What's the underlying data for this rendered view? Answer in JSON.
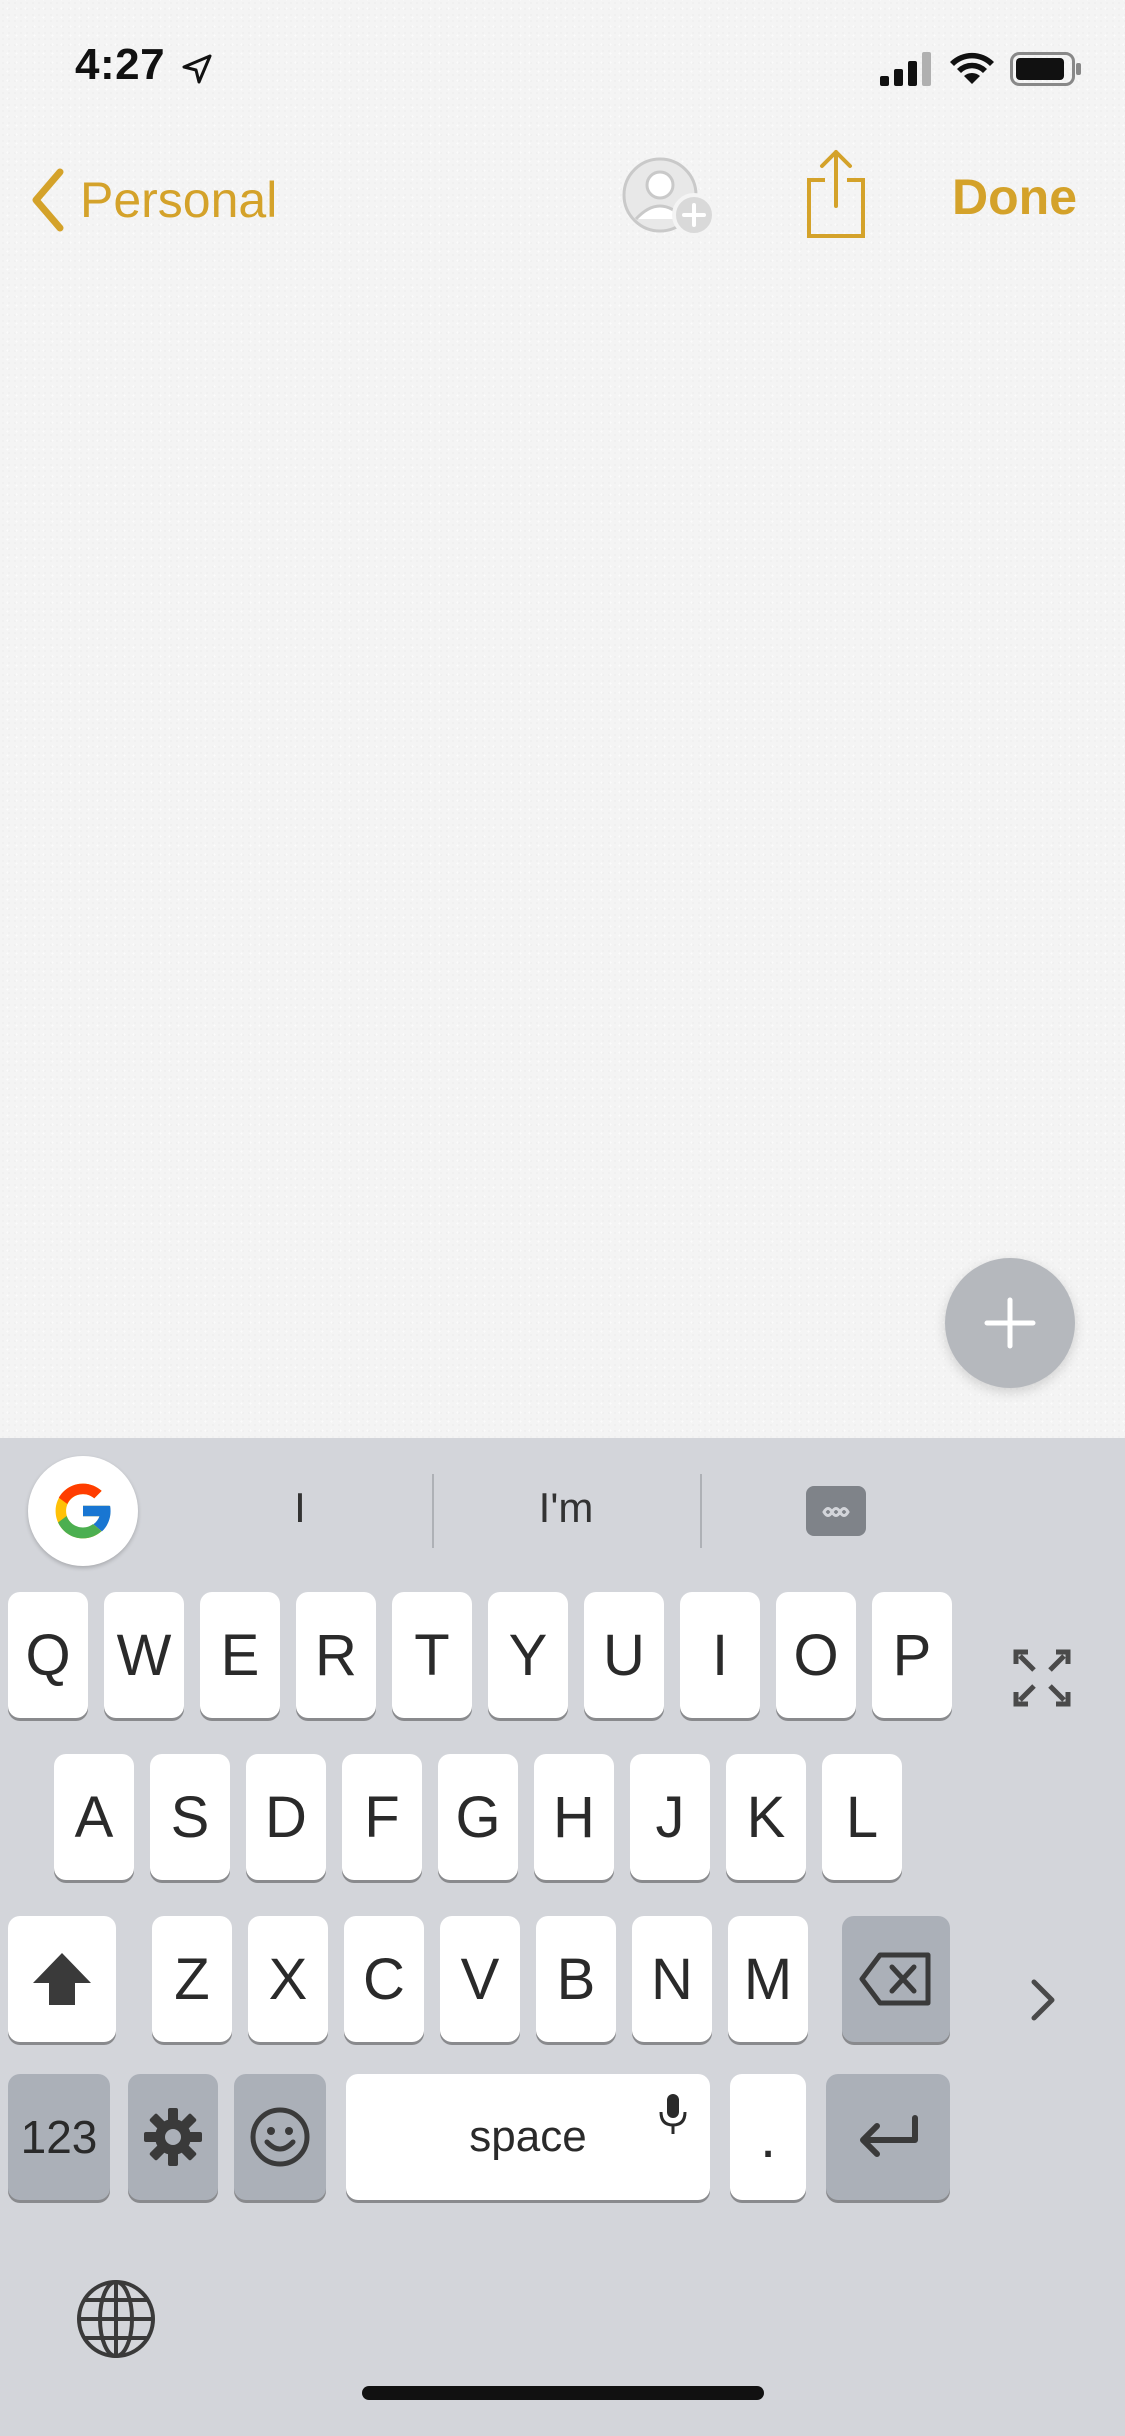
{
  "status_bar": {
    "time": "4:27"
  },
  "nav": {
    "back_label": "Personal",
    "done_label": "Done",
    "accent_color": "#d4a22a"
  },
  "keyboard": {
    "suggestions": [
      "I",
      "I'm"
    ],
    "row1": [
      "Q",
      "W",
      "E",
      "R",
      "T",
      "Y",
      "U",
      "I",
      "O",
      "P"
    ],
    "row2": [
      "A",
      "S",
      "D",
      "F",
      "G",
      "H",
      "J",
      "K",
      "L"
    ],
    "row3": [
      "Z",
      "X",
      "C",
      "V",
      "B",
      "N",
      "M"
    ],
    "numbers_label": "123",
    "space_label": "space",
    "period_label": "."
  },
  "icons": {
    "back": "chevron-left-icon",
    "add_person": "add-person-icon",
    "share": "share-icon",
    "add": "plus-icon",
    "google": "google-logo-icon",
    "camera": "camera-icon",
    "expand": "expand-icon",
    "shift": "shift-icon",
    "backspace": "backspace-icon",
    "settings": "gear-icon",
    "emoji": "emoji-icon",
    "mic": "microphone-icon",
    "return": "return-icon",
    "globe": "globe-icon",
    "next": "chevron-right-icon"
  }
}
